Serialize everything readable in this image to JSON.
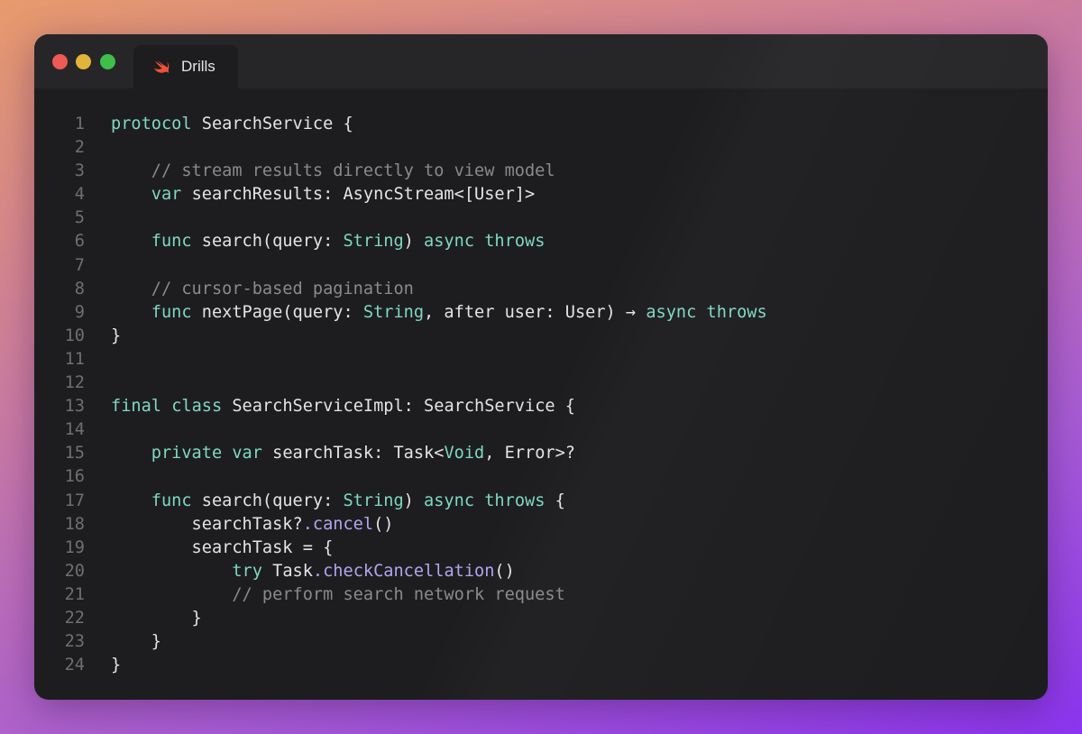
{
  "window": {
    "tab_label": "Drills",
    "tab_icon": "swift-icon",
    "colors": {
      "keyword": "#7fd8c2",
      "comment": "#8a8a8e",
      "method": "#b3a4f0",
      "text": "#e4e4e4",
      "line_number": "#6f6f73",
      "close": "#ee5a55",
      "minimize": "#e4b43a",
      "maximize": "#3fbe49"
    }
  },
  "code": {
    "lines": [
      {
        "n": "1",
        "tokens": [
          [
            "kw",
            "protocol"
          ],
          [
            "plain",
            " SearchService {"
          ]
        ]
      },
      {
        "n": "2",
        "tokens": []
      },
      {
        "n": "3",
        "tokens": [
          [
            "plain",
            "    "
          ],
          [
            "com",
            "// stream results directly to view model"
          ]
        ]
      },
      {
        "n": "4",
        "tokens": [
          [
            "plain",
            "    "
          ],
          [
            "kw",
            "var"
          ],
          [
            "plain",
            " searchResults: AsyncStream<[User]>"
          ]
        ]
      },
      {
        "n": "5",
        "tokens": []
      },
      {
        "n": "6",
        "tokens": [
          [
            "plain",
            "    "
          ],
          [
            "kw",
            "func"
          ],
          [
            "plain",
            " search(query: "
          ],
          [
            "type",
            "String"
          ],
          [
            "plain",
            ") "
          ],
          [
            "kw",
            "async"
          ],
          [
            "plain",
            " "
          ],
          [
            "kw",
            "throws"
          ]
        ]
      },
      {
        "n": "7",
        "tokens": []
      },
      {
        "n": "8",
        "tokens": [
          [
            "plain",
            "    "
          ],
          [
            "com",
            "// cursor-based pagination"
          ]
        ]
      },
      {
        "n": "9",
        "tokens": [
          [
            "plain",
            "    "
          ],
          [
            "kw",
            "func"
          ],
          [
            "plain",
            " nextPage(query: "
          ],
          [
            "type",
            "String"
          ],
          [
            "plain",
            ", after user: User) → "
          ],
          [
            "kw",
            "async"
          ],
          [
            "plain",
            " "
          ],
          [
            "kw",
            "throws"
          ]
        ]
      },
      {
        "n": "10",
        "tokens": [
          [
            "plain",
            "}"
          ]
        ]
      },
      {
        "n": "11",
        "tokens": []
      },
      {
        "n": "12",
        "tokens": []
      },
      {
        "n": "13",
        "tokens": [
          [
            "kw",
            "final"
          ],
          [
            "plain",
            " "
          ],
          [
            "kw",
            "class"
          ],
          [
            "plain",
            " SearchServiceImpl: SearchService {"
          ]
        ]
      },
      {
        "n": "14",
        "tokens": []
      },
      {
        "n": "15",
        "tokens": [
          [
            "plain",
            "    "
          ],
          [
            "kw",
            "private"
          ],
          [
            "plain",
            " "
          ],
          [
            "kw",
            "var"
          ],
          [
            "plain",
            " searchTask: Task<"
          ],
          [
            "type",
            "Void"
          ],
          [
            "plain",
            ", Error>?"
          ]
        ]
      },
      {
        "n": "16",
        "tokens": []
      },
      {
        "n": "17",
        "tokens": [
          [
            "plain",
            "    "
          ],
          [
            "kw",
            "func"
          ],
          [
            "plain",
            " search(query: "
          ],
          [
            "type",
            "String"
          ],
          [
            "plain",
            ") "
          ],
          [
            "kw",
            "async"
          ],
          [
            "plain",
            " "
          ],
          [
            "kw",
            "throws"
          ],
          [
            "plain",
            " {"
          ]
        ]
      },
      {
        "n": "18",
        "tokens": [
          [
            "plain",
            "        searchTask?"
          ],
          [
            "method",
            ".cancel"
          ],
          [
            "plain",
            "()"
          ]
        ]
      },
      {
        "n": "19",
        "tokens": [
          [
            "plain",
            "        searchTask = {"
          ]
        ]
      },
      {
        "n": "20",
        "tokens": [
          [
            "plain",
            "            "
          ],
          [
            "kw",
            "try"
          ],
          [
            "plain",
            " Task"
          ],
          [
            "method",
            ".checkCancellation"
          ],
          [
            "plain",
            "()"
          ]
        ]
      },
      {
        "n": "21",
        "tokens": [
          [
            "plain",
            "            "
          ],
          [
            "com",
            "// perform search network request"
          ]
        ]
      },
      {
        "n": "22",
        "tokens": [
          [
            "plain",
            "        }"
          ]
        ]
      },
      {
        "n": "23",
        "tokens": [
          [
            "plain",
            "    }"
          ]
        ]
      },
      {
        "n": "24",
        "tokens": [
          [
            "plain",
            "}"
          ]
        ]
      }
    ]
  }
}
